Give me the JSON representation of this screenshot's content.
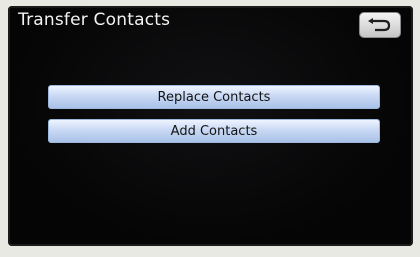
{
  "window": {
    "title": "Transfer Contacts"
  },
  "toolbar": {
    "back_icon": "return-arrow-icon"
  },
  "actions": {
    "replace_label": "Replace Contacts",
    "add_label": "Add Contacts"
  },
  "colors": {
    "screen_background": "#050505",
    "button_fill": "#c9d9f4",
    "button_border": "#9eb7dd"
  }
}
